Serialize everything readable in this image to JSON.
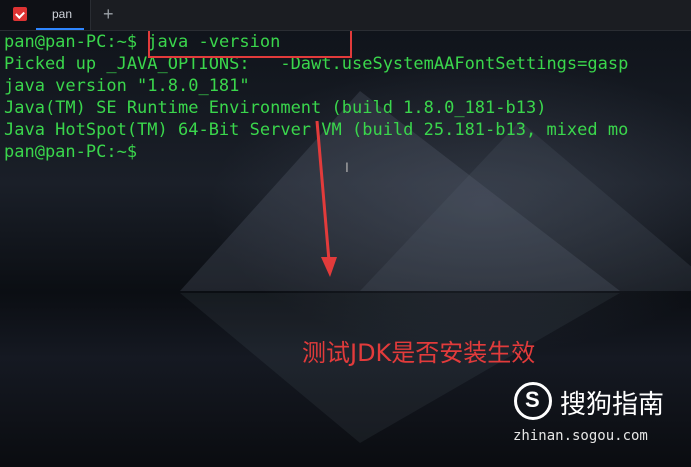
{
  "tab": {
    "label": "pan",
    "new_tab": "+"
  },
  "terminal": {
    "lines": [
      {
        "prompt": "pan@pan-PC:~$ ",
        "command": "java -version"
      },
      {
        "text": "Picked up _JAVA_OPTIONS:   -Dawt.useSystemAAFontSettings=gasp"
      },
      {
        "text": "java version \"1.8.0_181\""
      },
      {
        "text": "Java(TM) SE Runtime Environment (build 1.8.0_181-b13)"
      },
      {
        "text": "Java HotSpot(TM) 64-Bit Server VM (build 25.181-b13, mixed mo"
      },
      {
        "prompt": "pan@pan-PC:~$"
      }
    ]
  },
  "annotation": {
    "caption": "测试JDK是否安装生效",
    "color": "#e23b3b"
  },
  "watermark": {
    "brand": "搜狗指南",
    "url": "zhinan.sogou.com"
  },
  "colors": {
    "terminal_text": "#3ad64c",
    "tab_accent": "#2f86ff"
  }
}
